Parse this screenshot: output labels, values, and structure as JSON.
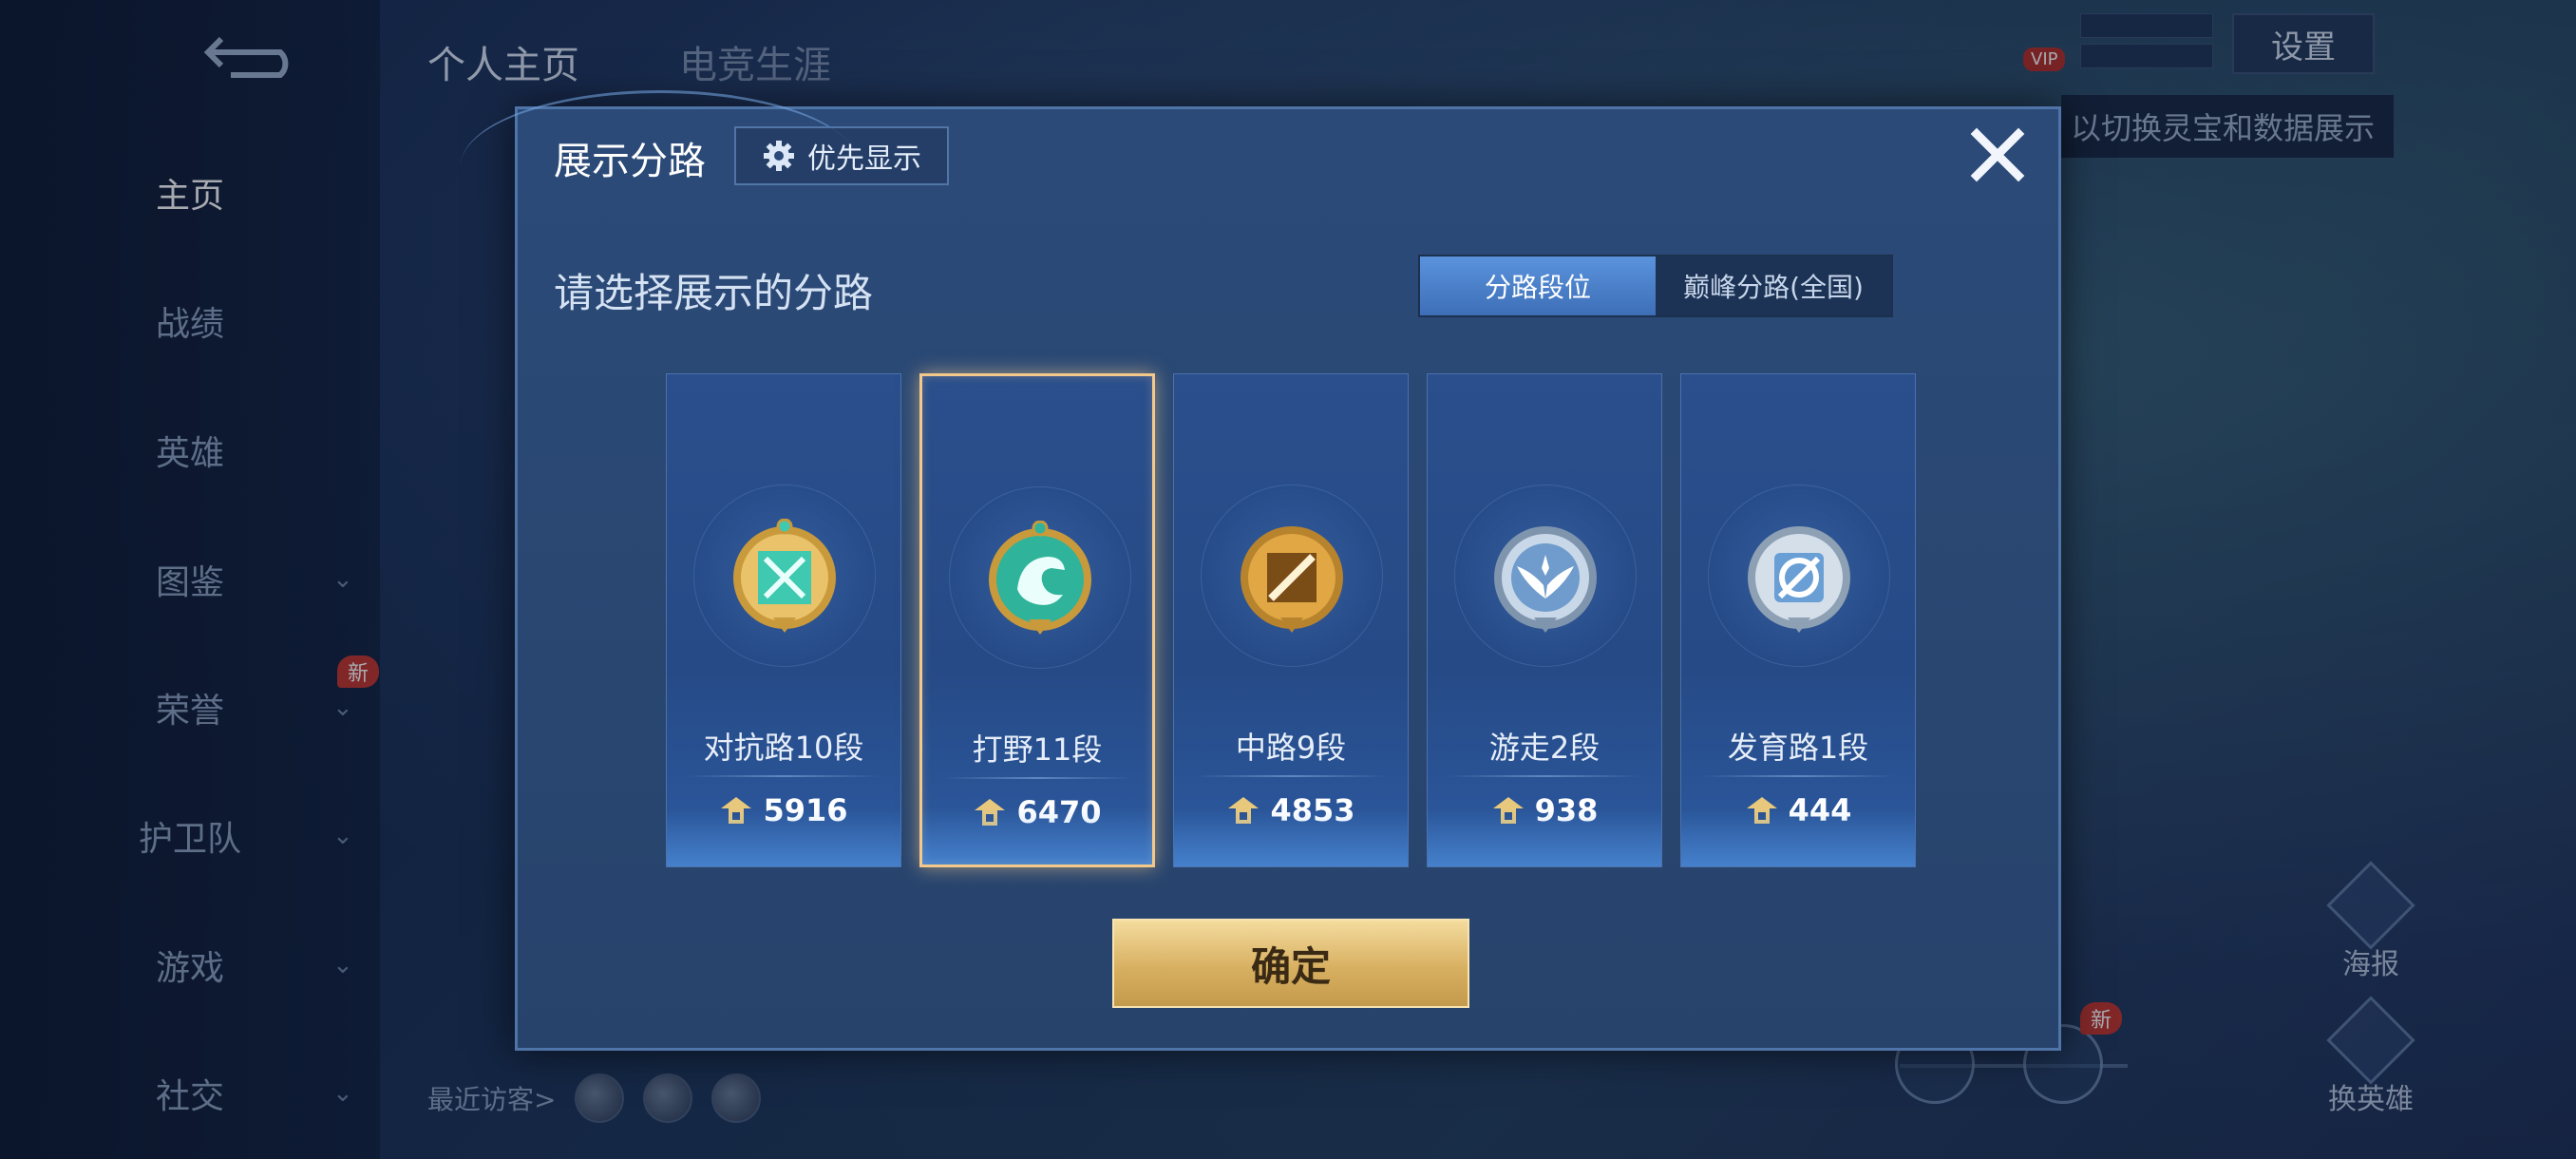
{
  "background": {
    "sidebar": {
      "items": [
        {
          "label": "主页",
          "active": true
        },
        {
          "label": "战绩"
        },
        {
          "label": "英雄"
        },
        {
          "label": "图鉴",
          "has_chevron": true
        },
        {
          "label": "荣誉",
          "has_chevron": true
        },
        {
          "label": "护卫队",
          "has_chevron": true
        },
        {
          "label": "游戏",
          "has_chevron": true
        },
        {
          "label": "社交",
          "has_chevron": true
        }
      ],
      "new_badge": "新"
    },
    "top_tabs": [
      "个人主页",
      "电竞生涯"
    ],
    "settings_label": "设置",
    "vip_label": "VIP",
    "hint_text": "以切换灵宝和数据展示",
    "recent_visitors_label": "最近访客>",
    "right_actions": [
      {
        "label": "海报",
        "icon": "poster-icon"
      },
      {
        "label": "换英雄",
        "icon": "switch-hero-icon"
      }
    ],
    "new_badge_2": "新"
  },
  "modal": {
    "title": "展示分路",
    "priority_label": "优先显示",
    "subtitle": "请选择展示的分路",
    "toggle": {
      "options": [
        "分路段位",
        "巅峰分路(全国)"
      ],
      "selected_index": 0
    },
    "cards": [
      {
        "rank": "对抗路10段",
        "score": "5916",
        "emblem": "clash-lane-emblem",
        "color": "#3ec9b0",
        "selected": false
      },
      {
        "rank": "打野11段",
        "score": "6470",
        "emblem": "jungle-dragon-emblem",
        "color": "#2fb39a",
        "selected": true
      },
      {
        "rank": "中路9段",
        "score": "4853",
        "emblem": "mid-lane-emblem",
        "color": "#d79a3b",
        "selected": false
      },
      {
        "rank": "游走2段",
        "score": "938",
        "emblem": "roam-wings-emblem",
        "color": "#a9c3de",
        "selected": false
      },
      {
        "rank": "发育路1段",
        "score": "444",
        "emblem": "farm-lane-emblem",
        "color": "#8fb5e0",
        "selected": false
      }
    ],
    "confirm_label": "确定"
  },
  "colors": {
    "accent_gold": "#d8b062",
    "selected_border": "#f2c98a",
    "modal_bg": "#2a4873",
    "toggle_selected": "#3d6fb7"
  }
}
